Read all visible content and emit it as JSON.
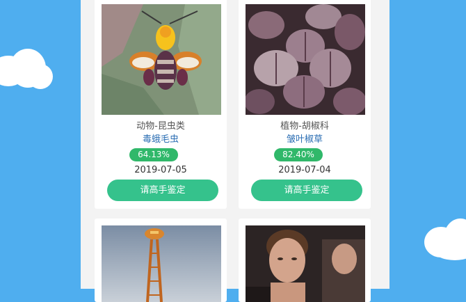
{
  "colors": {
    "background": "#4faeef",
    "panel": "#f3f3f3",
    "accuracy_badge": "#30b86a",
    "expert_button": "#35c28c",
    "name_text": "#2d6fb4"
  },
  "cards": [
    {
      "category": "动物-昆虫类",
      "name": "毒蛾毛虫",
      "accuracy": "64.13%",
      "date": "2019-07-05",
      "button_label": "请高手鉴定",
      "image": "caterpillar-photo"
    },
    {
      "category": "植物-胡椒科",
      "name": "皱叶椒草",
      "accuracy": "82.40%",
      "date": "2019-07-04",
      "button_label": "请高手鉴定",
      "image": "peperomia-plant-photo"
    },
    {
      "image": "tower-photo"
    },
    {
      "image": "man-portrait-photo"
    }
  ]
}
